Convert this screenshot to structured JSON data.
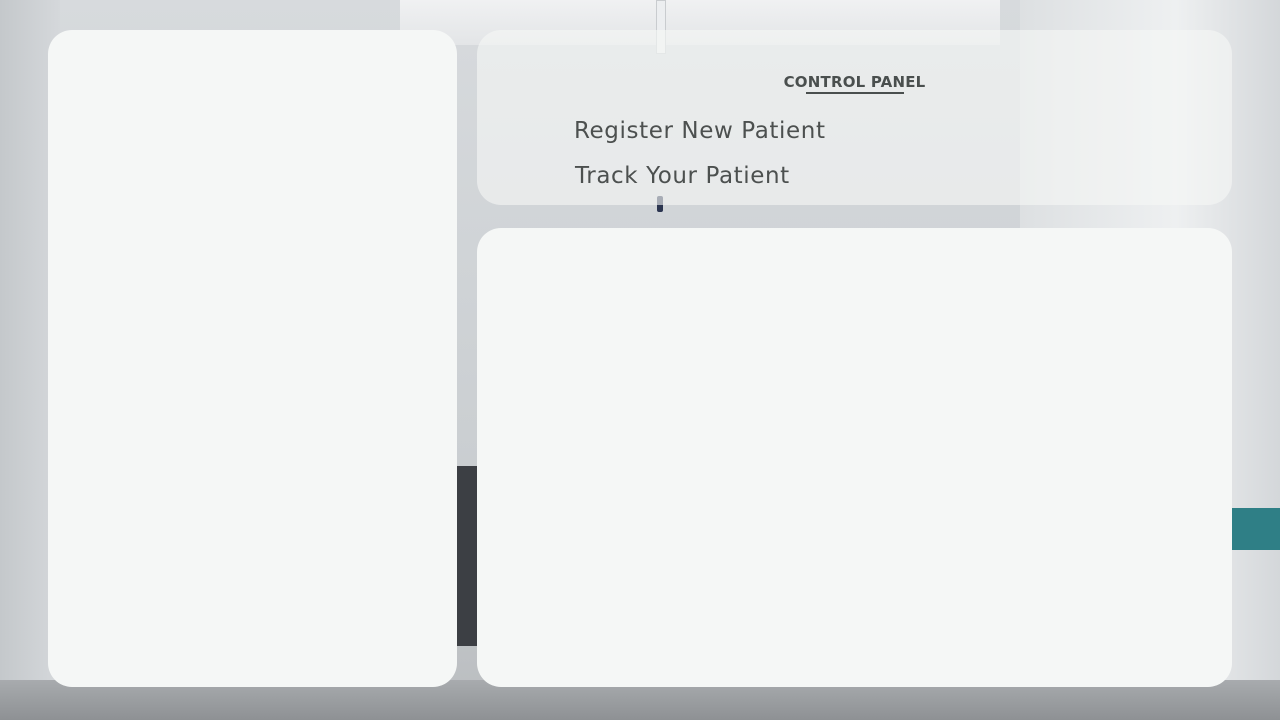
{
  "control_panel": {
    "title": "CONTROL PANEL",
    "menu_items": [
      {
        "label": "Register New Patient"
      },
      {
        "label": "Track Your Patient"
      }
    ]
  },
  "colors": {
    "panel_background": "#f5f7f6",
    "text": "#4a4f4e"
  }
}
